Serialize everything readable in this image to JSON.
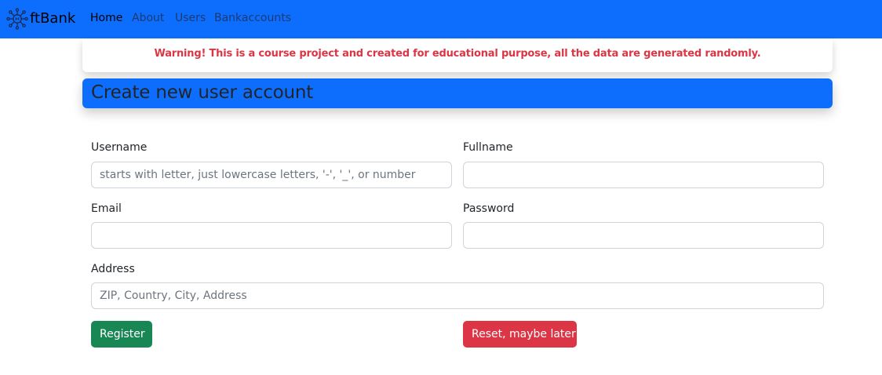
{
  "nav": {
    "brand_text": "ftBank",
    "links": [
      {
        "label": "Home",
        "active": true
      },
      {
        "label": "About"
      },
      {
        "label": "Users"
      },
      {
        "label": "Bankaccounts"
      }
    ]
  },
  "warning_text": "Warning! This is a course project and created for educational purpose, all the data are generated randomly.",
  "page_title": "Create new user account",
  "form": {
    "username": {
      "label": "Username",
      "placeholder": "starts with letter, just lowercase letters, '-', '_', or number",
      "value": ""
    },
    "fullname": {
      "label": "Fullname",
      "placeholder": "",
      "value": ""
    },
    "email": {
      "label": "Email",
      "placeholder": "",
      "value": ""
    },
    "password": {
      "label": "Password",
      "placeholder": "",
      "value": ""
    },
    "address": {
      "label": "Address",
      "placeholder": "ZIP, Country, City, Address",
      "value": ""
    },
    "register_label": "Register",
    "reset_label": "Reset, maybe later"
  },
  "colors": {
    "navbar": "#0d6efd",
    "warning_text": "#dc3545",
    "register": "#198754",
    "reset": "#dc3545"
  }
}
